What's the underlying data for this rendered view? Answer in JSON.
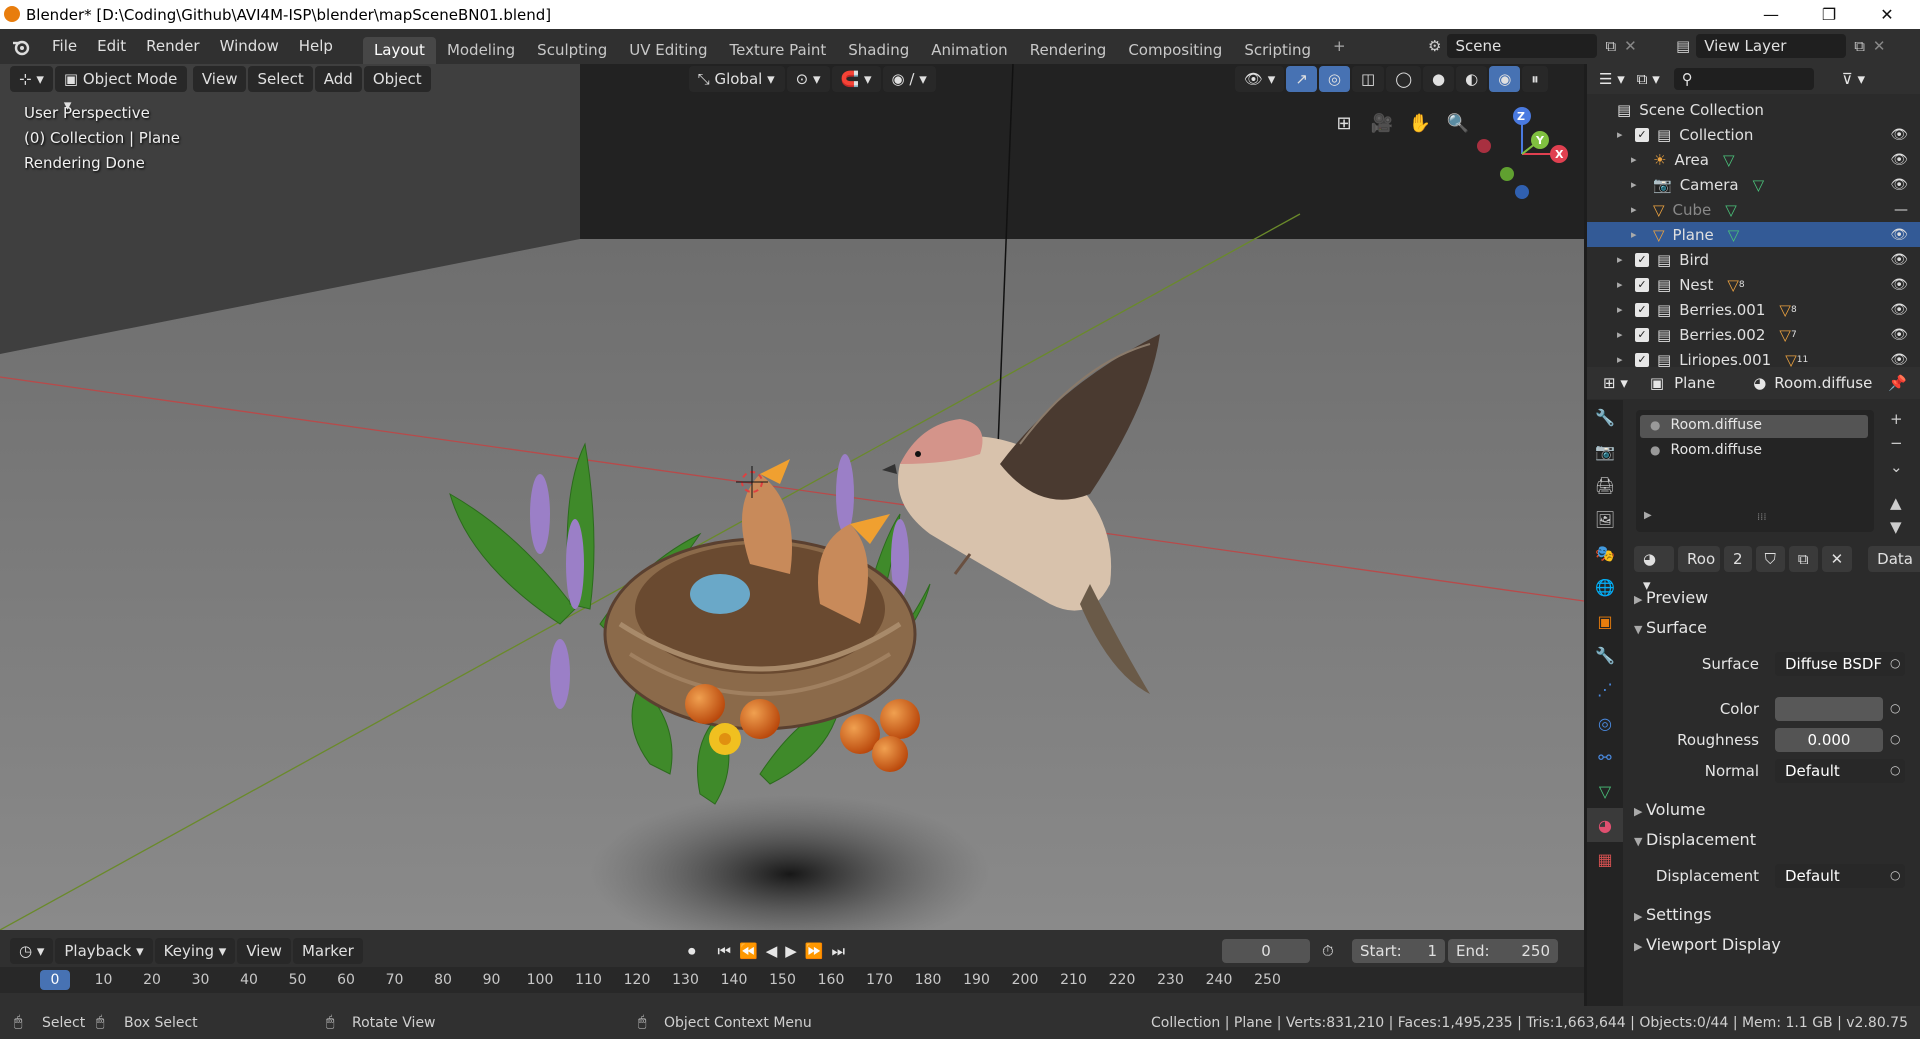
{
  "window": {
    "title": "Blender* [D:\\Coding\\Github\\AVI4M-ISP\\blender\\mapSceneBN01.blend]",
    "minimize": "—",
    "maximize": "❐",
    "close": "✕"
  },
  "menus": [
    "File",
    "Edit",
    "Render",
    "Window",
    "Help"
  ],
  "workspaces": [
    {
      "label": "Layout",
      "active": true
    },
    {
      "label": "Modeling"
    },
    {
      "label": "Sculpting"
    },
    {
      "label": "UV Editing"
    },
    {
      "label": "Texture Paint"
    },
    {
      "label": "Shading"
    },
    {
      "label": "Animation"
    },
    {
      "label": "Rendering"
    },
    {
      "label": "Compositing"
    },
    {
      "label": "Scripting"
    }
  ],
  "add_workspace": "+",
  "scene_name": "Scene",
  "view_layer": "View Layer",
  "viewport": {
    "mode": "Object Mode",
    "menus": [
      "View",
      "Select",
      "Add",
      "Object"
    ],
    "orientation": "Global",
    "overlay_lines": [
      "User Perspective",
      "(0) Collection | Plane",
      "Rendering Done"
    ],
    "gizmo": {
      "z": "Z",
      "y": "Y",
      "x": "X"
    }
  },
  "outliner": {
    "root": "Scene Collection",
    "items": [
      {
        "label": "Collection",
        "indent": 0,
        "type": "collection"
      },
      {
        "label": "Area",
        "indent": 1,
        "type": "light"
      },
      {
        "label": "Camera",
        "indent": 1,
        "type": "camera"
      },
      {
        "label": "Cube",
        "indent": 1,
        "type": "mesh",
        "dim": true
      },
      {
        "label": "Plane",
        "indent": 1,
        "type": "mesh",
        "selected": true
      },
      {
        "label": "Bird",
        "indent": 0,
        "type": "collection"
      },
      {
        "label": "Nest",
        "indent": 0,
        "type": "collection",
        "badge": "8"
      },
      {
        "label": "Berries.001",
        "indent": 0,
        "type": "collection",
        "badge": "8"
      },
      {
        "label": "Berries.002",
        "indent": 0,
        "type": "collection",
        "badge": "7"
      },
      {
        "label": "Liriopes.001",
        "indent": 0,
        "type": "collection",
        "badge": "11"
      }
    ]
  },
  "properties": {
    "object": "Plane",
    "material": "Room.diffuse",
    "slots": [
      "Room.diffuse",
      "Room.diffuse"
    ],
    "mat_short": "Roo",
    "users": "2",
    "link": "Data",
    "sections": {
      "preview": "Preview",
      "surface": "Surface",
      "volume": "Volume",
      "displacement": "Displacement",
      "settings": "Settings",
      "viewport_display": "Viewport Display"
    },
    "surface_label": "Surface",
    "surface_value": "Diffuse BSDF",
    "color_label": "Color",
    "roughness_label": "Roughness",
    "roughness_value": "0.000",
    "normal_label": "Normal",
    "normal_value": "Default",
    "disp_label": "Displacement",
    "disp_value": "Default"
  },
  "timeline": {
    "menus": [
      "Playback",
      "Keying",
      "View",
      "Marker"
    ],
    "current_frame": "0",
    "start_label": "Start:",
    "start": "1",
    "end_label": "End:",
    "end": "250",
    "ticks": [
      "0",
      "10",
      "20",
      "30",
      "40",
      "50",
      "60",
      "70",
      "80",
      "90",
      "100",
      "110",
      "120",
      "130",
      "140",
      "150",
      "160",
      "170",
      "180",
      "190",
      "200",
      "210",
      "220",
      "230",
      "240",
      "250"
    ]
  },
  "status": {
    "select": "Select",
    "box_select": "Box Select",
    "rotate": "Rotate View",
    "context": "Object Context Menu",
    "stats": "Collection | Plane | Verts:831,210 | Faces:1,495,235 | Tris:1,663,644 | Objects:0/44 | Mem: 1.1 GB | v2.80.75"
  },
  "colors": {
    "accent": "#335a96",
    "blender_orange": "#e87d0d",
    "header": "#303030",
    "panel": "#2b2b2b"
  }
}
